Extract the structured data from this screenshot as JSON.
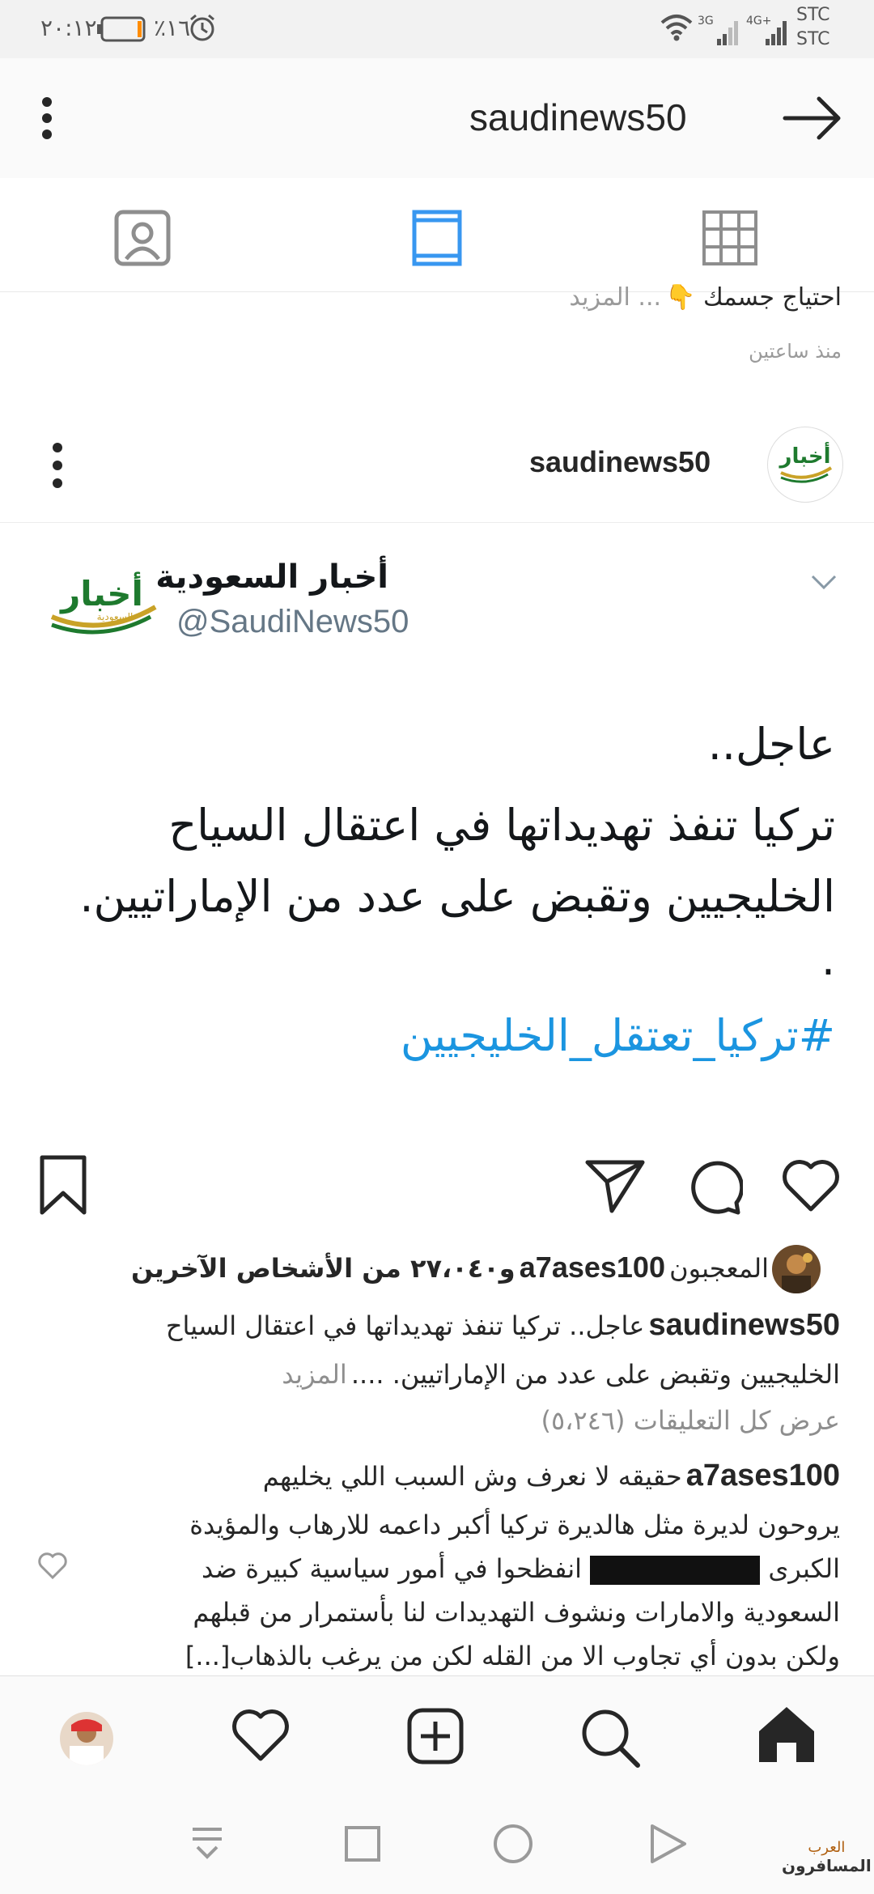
{
  "status_bar": {
    "time": "٢٠:١٢",
    "battery": "٪١٦",
    "battery_level": 0.16,
    "carrier_1": "STC",
    "carrier_2": "STC",
    "net_1": "3G",
    "net_2": "4G+"
  },
  "app_bar": {
    "title": "saudinews50",
    "icons": [
      "more-vertical-icon",
      "arrow-right-icon"
    ]
  },
  "tabs": {
    "icons": [
      "person-tag-icon",
      "feed-icon",
      "grid-icon"
    ],
    "active_index": 1,
    "accent_color": "#3897f0"
  },
  "previous_post": {
    "caption": "احتياج جسمك 👇",
    "more": "... المزيد",
    "time": "منذ ساعتين"
  },
  "post": {
    "username": "saudinews50",
    "avatar_icon": "akhbar-logo-icon",
    "tweet": {
      "name": "أخبار السعودية",
      "handle": "@SaudiNews50",
      "logo_text": "أخبار",
      "logo_subtext": "السعودية",
      "lines": [
        "عاجل..",
        "تركيا تنفذ تهديداتها في اعتقال السياح",
        "الخليجيين وتقبض على عدد من الإماراتيين.",
        "."
      ],
      "hashtag": "#تركيا_تعتقل_الخليجيين"
    },
    "likes": {
      "prefix": "المعجبون",
      "user": "a7ases100",
      "count_text": "و٢٧،٠٤٠ من الأشخاص الآخرين"
    },
    "caption": {
      "user": "saudinews50",
      "line1": "عاجل.. تركيا تنفذ تهديداتها في اعتقال السياح",
      "line2": "الخليجيين وتقبض على عدد من الإماراتيين. ....",
      "more": "المزيد"
    },
    "view_comments": "عرض كل التعليقات (٥،٢٤٦)",
    "comment": {
      "user": "a7ases100",
      "line1": "حقيقه لا نعرف وش السبب اللي يخليهم",
      "line2": "يروحون لديرة مثل هالديرة تركيا أكبر داعمه للارهاب والمؤيدة",
      "line3_start": "الكبرى",
      "line3_end": "انفظحوا في أمور سياسية كبيرة ضد",
      "line4": "السعودية والامارات ونشوف التهديدات لنا بأستمرار من قبلهم",
      "line5": "ولكن بدون أي تجاوب الا من القله لكن من يرغب بالذهاب[...]"
    }
  },
  "bottom_nav": {
    "icons": [
      "profile-avatar-icon",
      "heart-icon",
      "add-post-icon",
      "search-icon",
      "home-icon"
    ]
  },
  "system_nav": {
    "icons": [
      "notification-pull-icon",
      "recents-square-icon",
      "home-circle-icon",
      "back-triangle-icon"
    ],
    "watermark_top": "العرب",
    "watermark_bottom": "المسافرون"
  }
}
